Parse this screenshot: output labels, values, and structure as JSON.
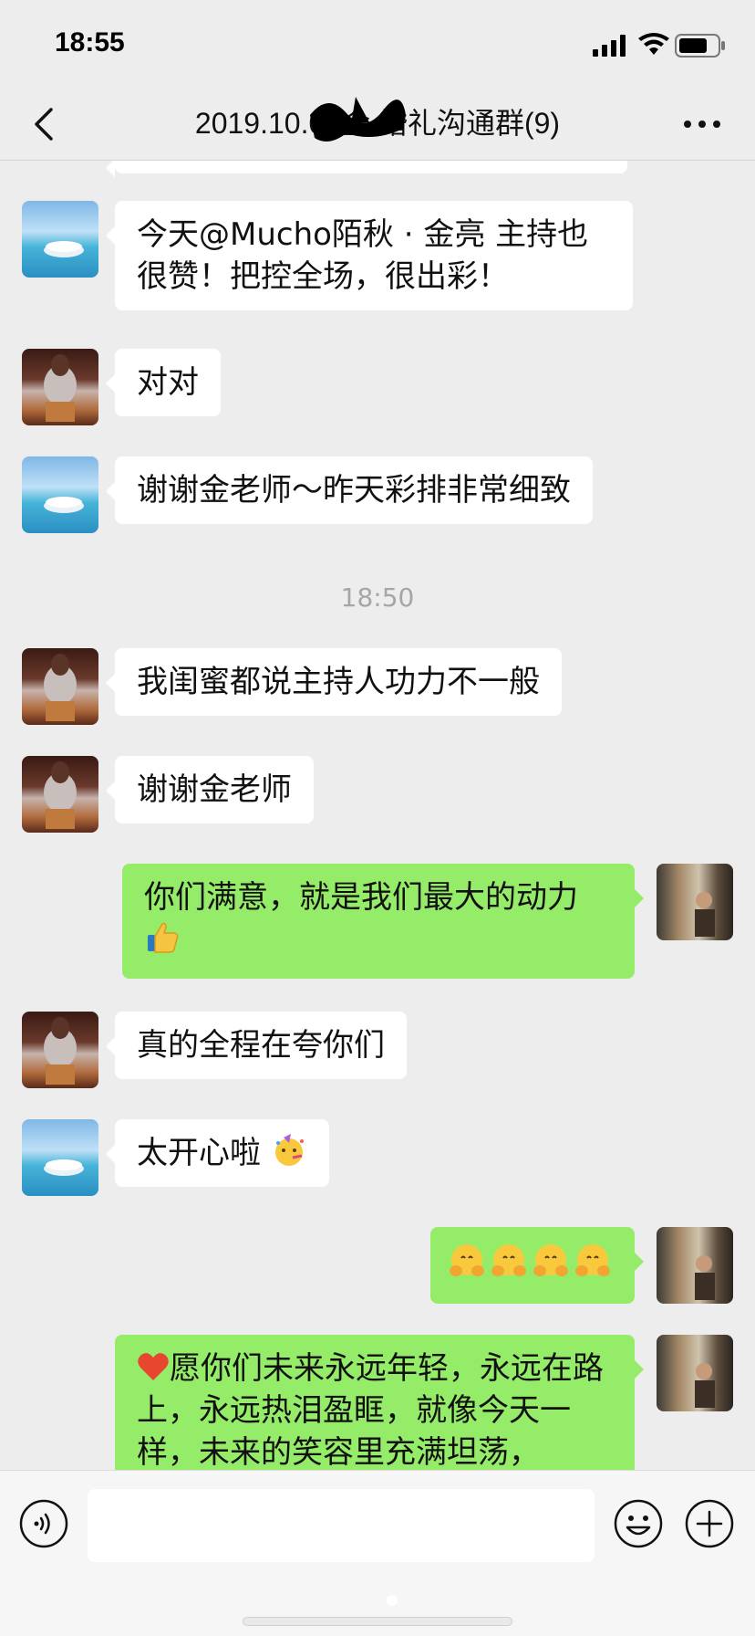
{
  "status_bar": {
    "time": "18:55"
  },
  "header": {
    "title": "2019.10.02金     婚礼沟通群(9)"
  },
  "messages": [
    {
      "side": "left",
      "avatar": "sea-avatar",
      "text": "今天@Mucho陌秋 · 金亮 主持也很赞！把控全场，很出彩！"
    },
    {
      "side": "left",
      "avatar": "girl-avatar",
      "text": "对对"
    },
    {
      "side": "left",
      "avatar": "sea-avatar",
      "text": "谢谢金老师～昨天彩排非常细致"
    },
    {
      "type": "time",
      "text": "18:50"
    },
    {
      "side": "left",
      "avatar": "girl-avatar",
      "text": "我闺蜜都说主持人功力不一般"
    },
    {
      "side": "left",
      "avatar": "girl-avatar",
      "text": "谢谢金老师"
    },
    {
      "side": "right",
      "avatar": "man-avatar",
      "text": "你们满意，就是我们最大的动力",
      "emoji": "thumbs-up-icon"
    },
    {
      "side": "left",
      "avatar": "girl-avatar",
      "text": "真的全程在夸你们"
    },
    {
      "side": "left",
      "avatar": "sea-avatar",
      "text": "太开心啦",
      "emoji": "party-face-icon"
    },
    {
      "side": "right",
      "avatar": "man-avatar",
      "emoji": "hugging-face-icon ×4"
    },
    {
      "side": "right",
      "avatar": "man-avatar",
      "emoji": "heart-icon",
      "text": "愿你们未来永远年轻，永远在路上，永远热泪盈眶，就像今天一样，未来的笑容里充满坦荡，"
    }
  ],
  "icons": [
    "back-icon",
    "more-icon",
    "voice-icon",
    "emoji-icon",
    "plus-icon"
  ],
  "colors": {
    "background": "#ededed",
    "sent_bubble": "#95ec69",
    "received_bubble": "#ffffff",
    "timestamp": "#a6a6a6"
  }
}
